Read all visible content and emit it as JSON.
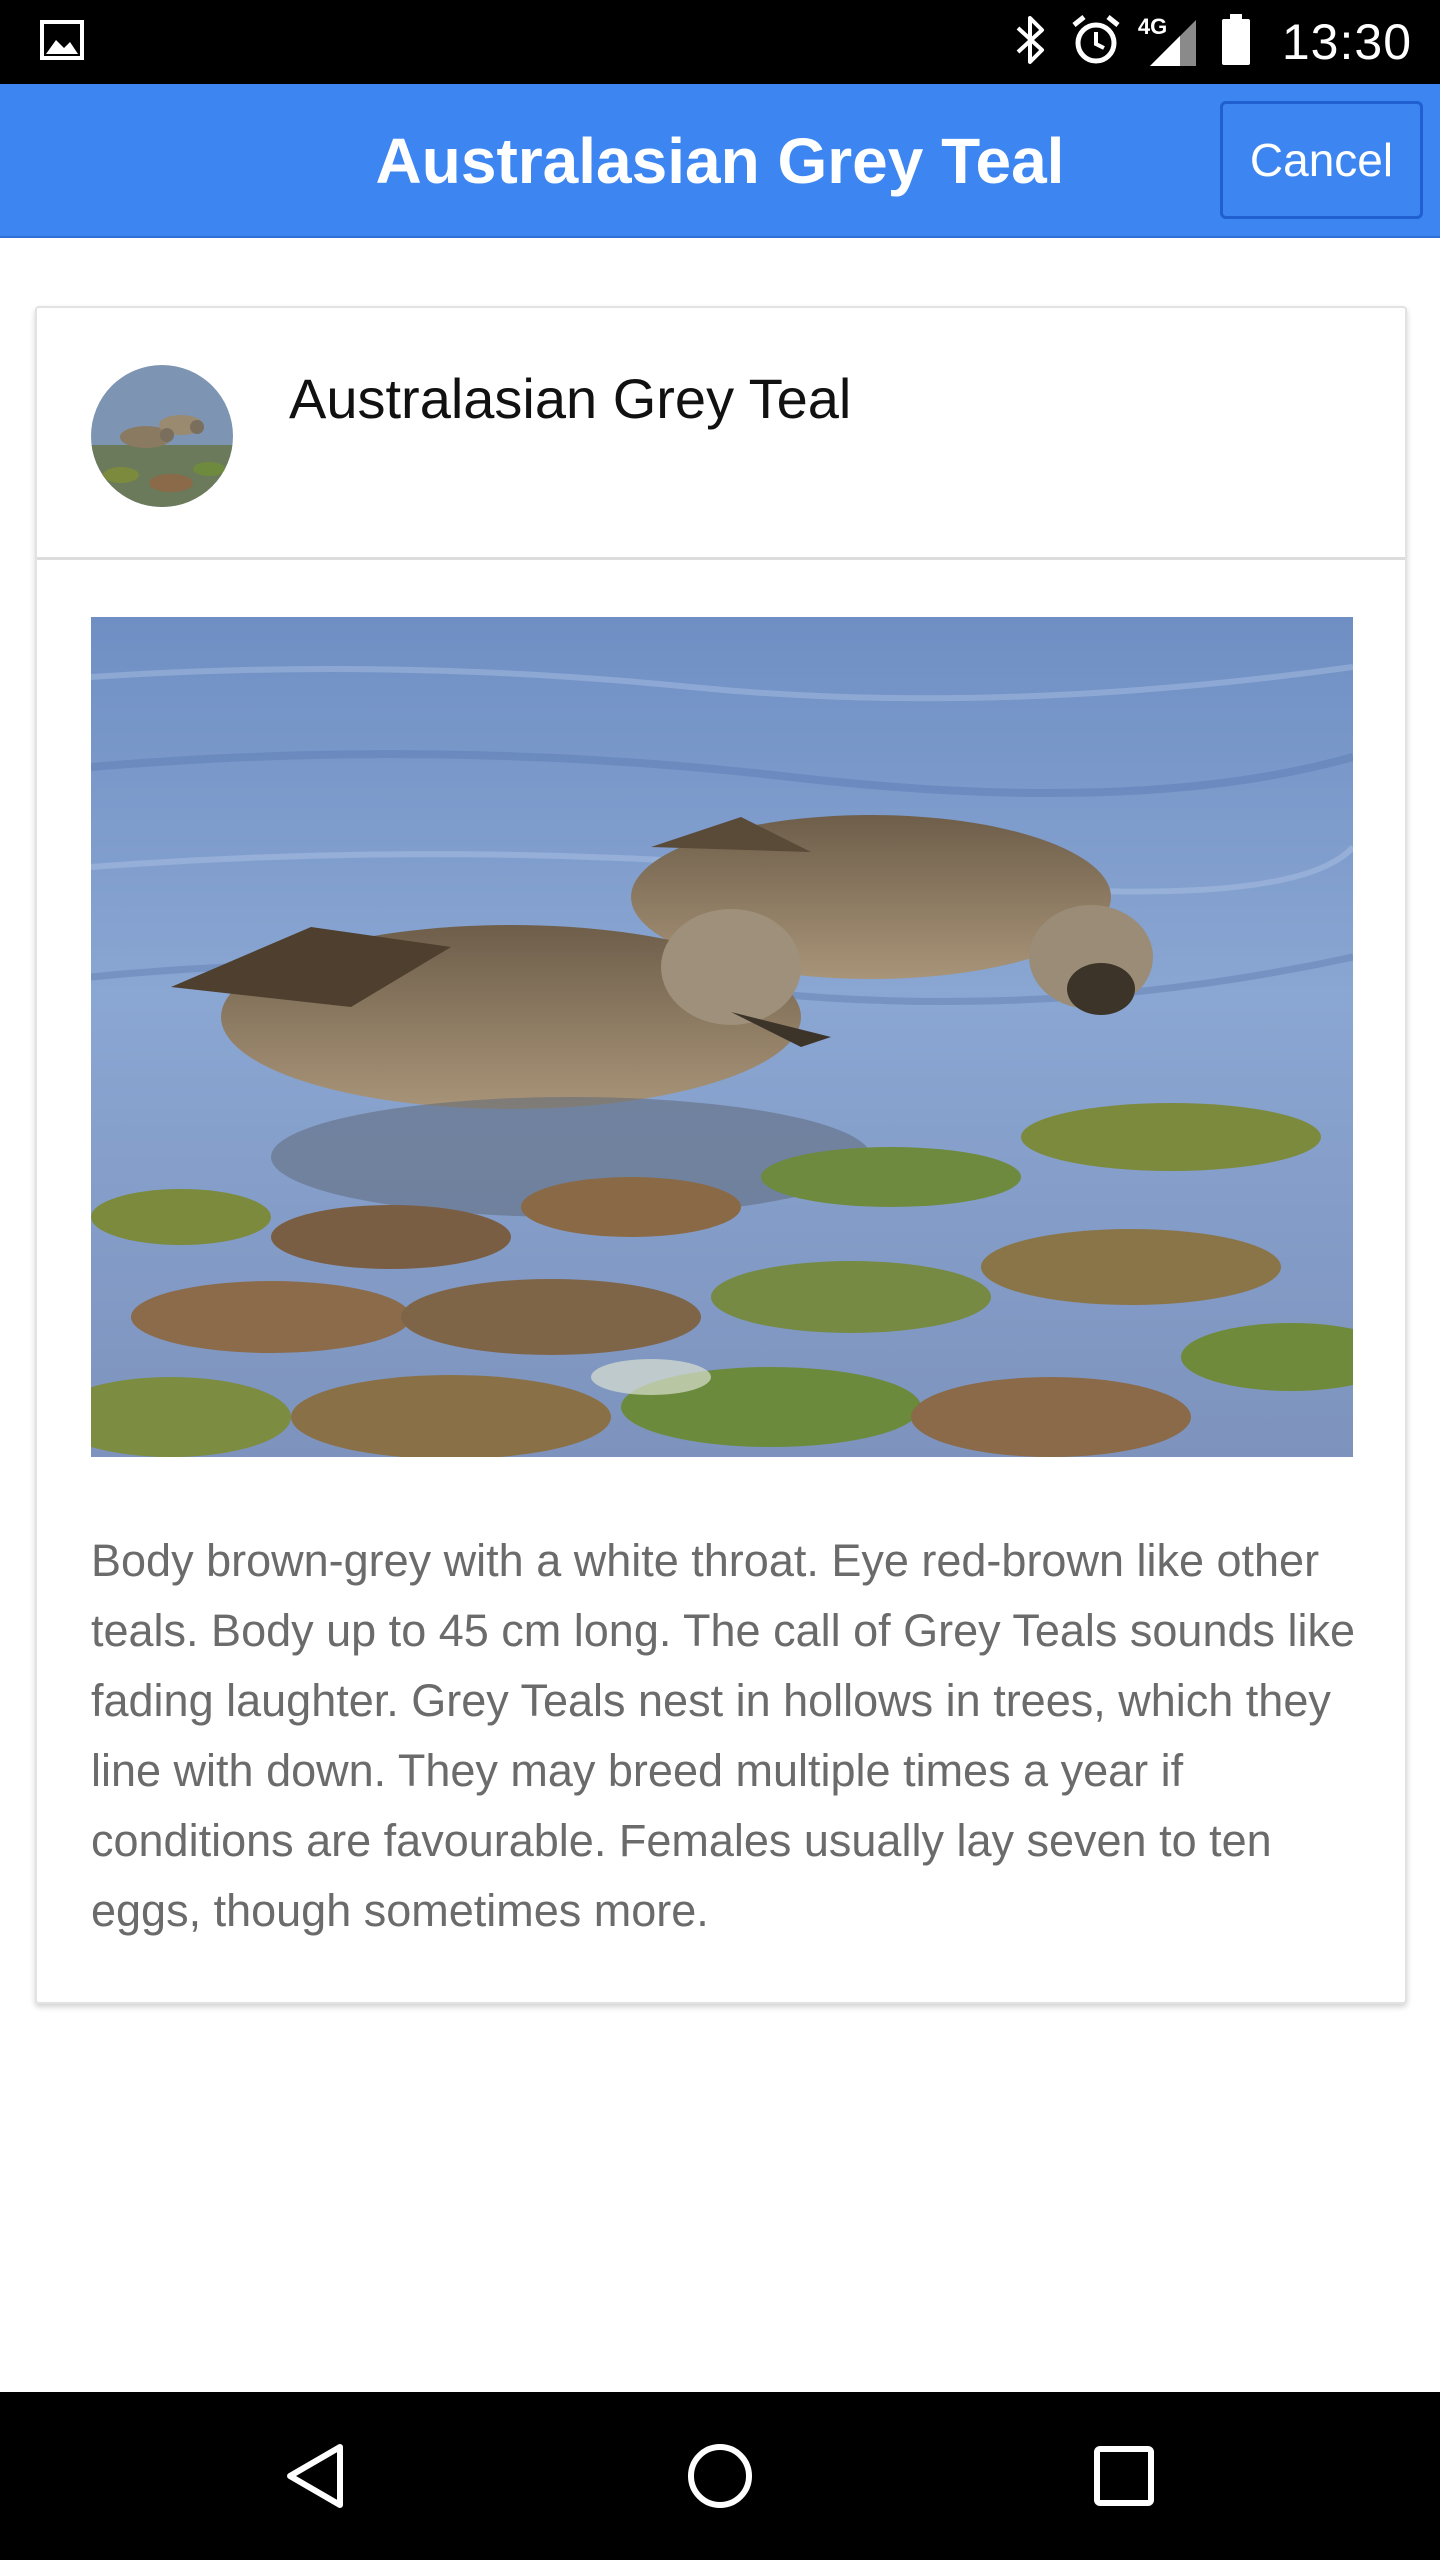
{
  "status_bar": {
    "network_label": "4G",
    "time": "13:30"
  },
  "app_bar": {
    "title": "Australasian Grey Teal",
    "cancel_label": "Cancel",
    "color": "#3d86f2"
  },
  "card": {
    "title": "Australasian Grey Teal",
    "description": "Body brown-grey with a white throat. Eye red-brown like other teals. Body up to 45 cm long. The call of Grey Teals sounds like fading laughter. Grey Teals nest in hollows in trees, which they line with down. They may breed multiple times a year if conditions are favourable. Females usually lay seven to ten eggs, though sometimes more."
  },
  "icons": {
    "status_left": "image-notification-icon",
    "status_right": [
      "bluetooth-icon",
      "alarm-icon",
      "cell-signal-icon",
      "battery-icon"
    ],
    "nav": [
      "back-icon",
      "home-icon",
      "recents-icon"
    ]
  }
}
